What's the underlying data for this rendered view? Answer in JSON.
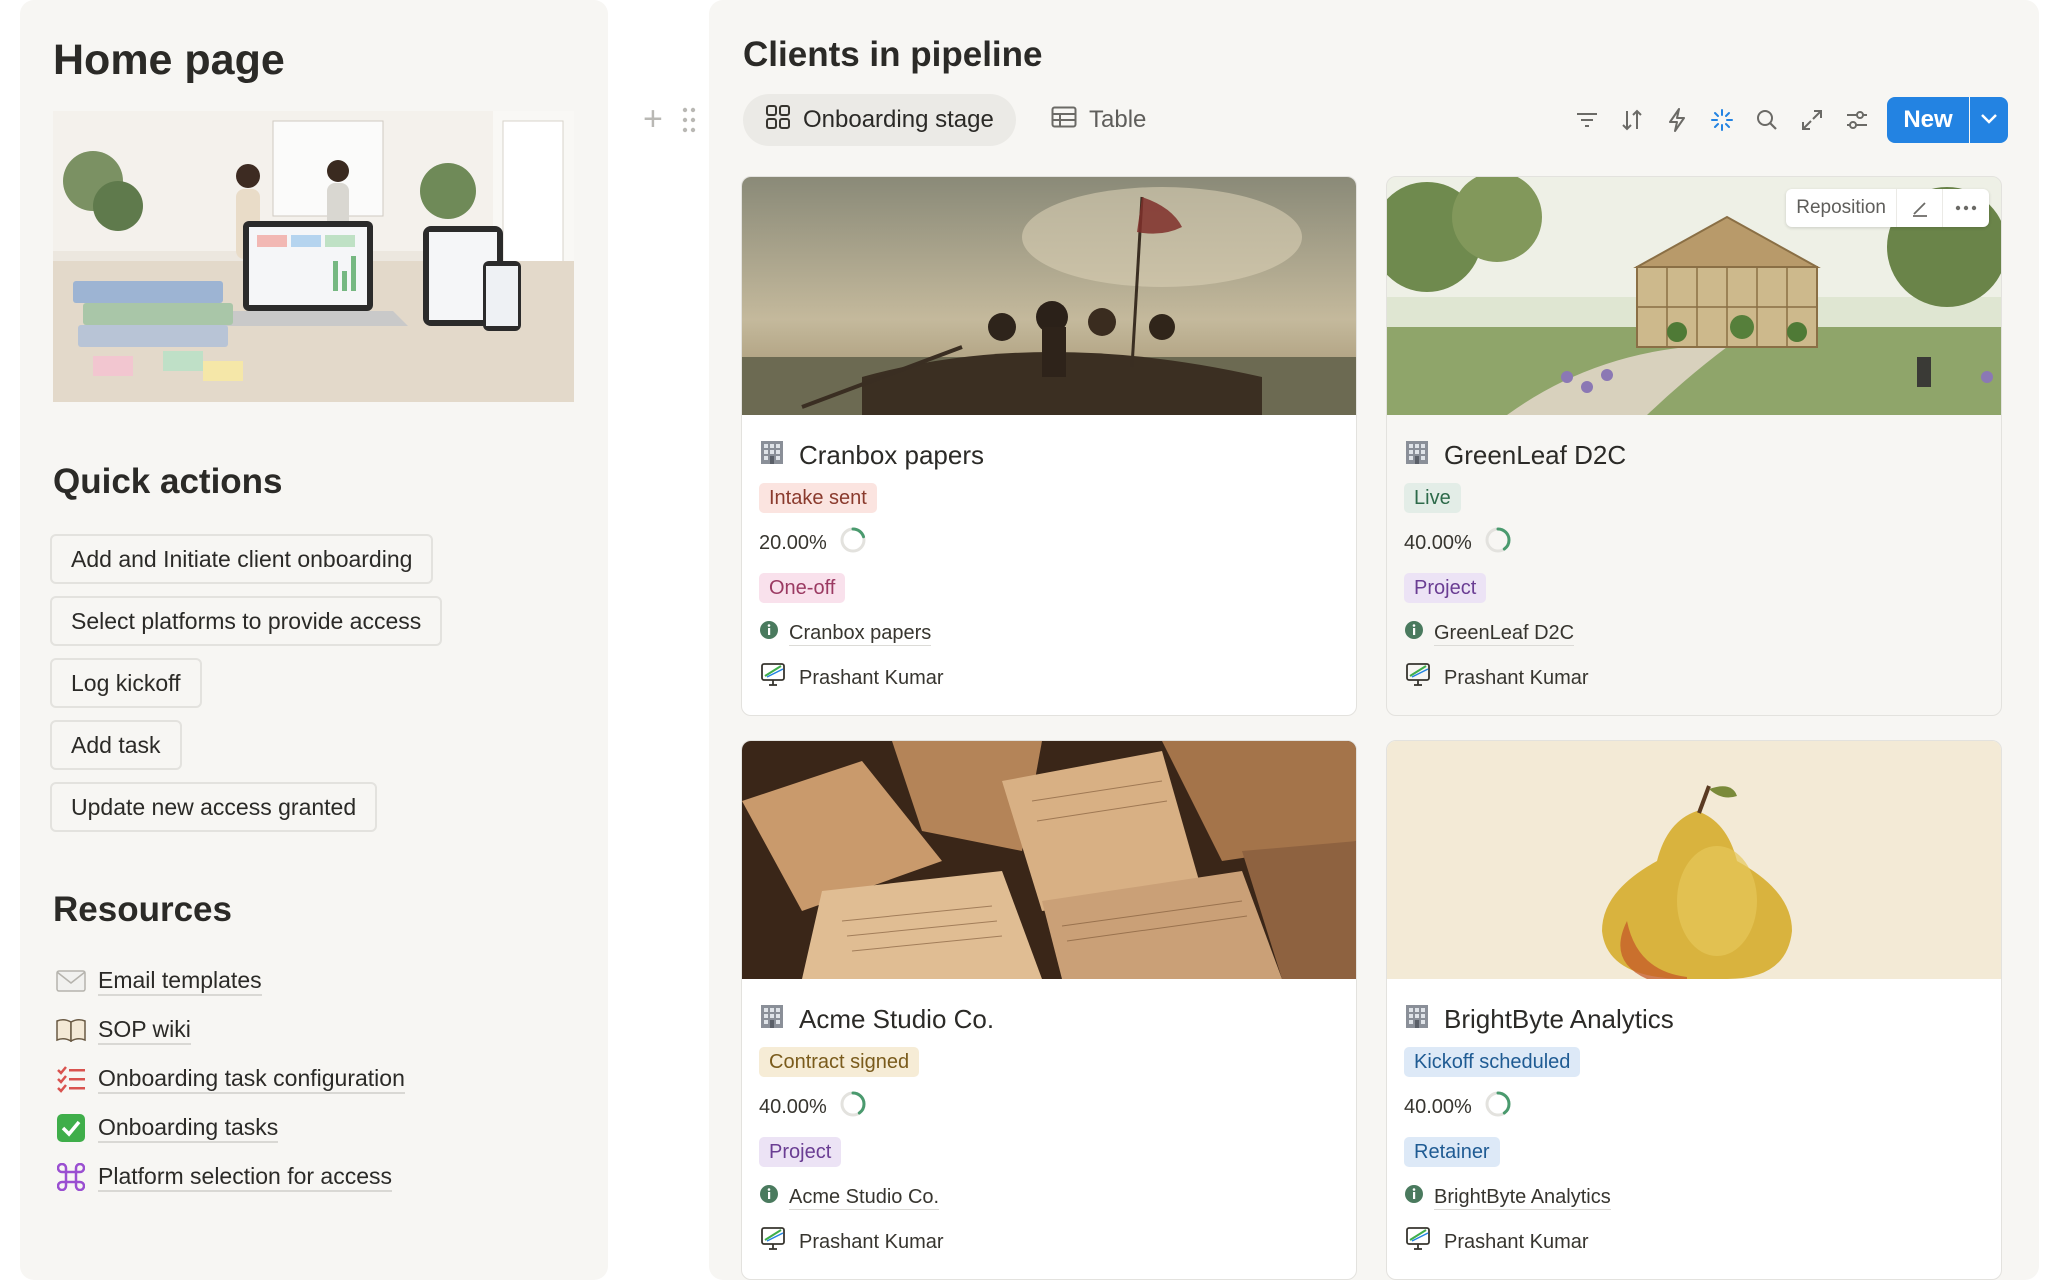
{
  "left": {
    "title": "Home page",
    "quick_actions_title": "Quick actions",
    "quick_actions": [
      {
        "label": "Add and Initiate client onboarding"
      },
      {
        "label": "Select platforms to provide access"
      },
      {
        "label": "Log kickoff"
      },
      {
        "label": "Add task"
      },
      {
        "label": "Update new access granted"
      }
    ],
    "resources_title": "Resources",
    "resources": [
      {
        "label": "Email templates",
        "icon": "envelope-icon"
      },
      {
        "label": "SOP wiki",
        "icon": "book-icon"
      },
      {
        "label": "Onboarding task configuration",
        "icon": "checklist-icon"
      },
      {
        "label": "Onboarding tasks",
        "icon": "check-box-icon"
      },
      {
        "label": "Platform selection for access",
        "icon": "command-key-icon"
      }
    ]
  },
  "right": {
    "title": "Clients in pipeline",
    "views": [
      {
        "label": "Onboarding stage",
        "icon": "gallery-icon",
        "active": true
      },
      {
        "label": "Table",
        "icon": "table-icon",
        "active": false
      }
    ],
    "toolbar_icons": [
      "filter-icon",
      "sort-icon",
      "automation-icon",
      "sparkle-icon",
      "search-icon",
      "expand-icon",
      "settings-icon"
    ],
    "new_label": "New",
    "reposition_label": "Reposition",
    "cards": [
      {
        "title": "Cranbox papers",
        "status": "Intake sent",
        "progress_label": "20.00%",
        "progress": 0.2,
        "type": "One-off",
        "company": "Cranbox papers",
        "owner": "Prashant Kumar",
        "cover": "painting-river-crossing"
      },
      {
        "title": "GreenLeaf D2C",
        "status": "Live",
        "progress_label": "40.00%",
        "progress": 0.4,
        "type": "Project",
        "company": "GreenLeaf D2C",
        "owner": "Prashant Kumar",
        "cover": "greenhouse-garden"
      },
      {
        "title": "Acme Studio Co.",
        "status": "Contract signed",
        "progress_label": "40.00%",
        "progress": 0.4,
        "type": "Project",
        "company": "Acme Studio Co.",
        "owner": "Prashant Kumar",
        "cover": "open-books"
      },
      {
        "title": "BrightByte Analytics",
        "status": "Kickoff scheduled",
        "progress_label": "40.00%",
        "progress": 0.4,
        "type": "Retainer",
        "company": "BrightByte Analytics",
        "owner": "Prashant Kumar",
        "cover": "pear"
      }
    ]
  },
  "colors": {
    "accent": "#2383e2",
    "status_red_bg": "#fbe4e0",
    "status_red_fg": "#8a3a2d",
    "status_green_bg": "#e3ede7",
    "status_green_fg": "#2d6a4a",
    "status_yellow_bg": "#f6ecd6",
    "status_yellow_fg": "#7a5b1c",
    "status_blue_bg": "#dde9f7",
    "status_blue_fg": "#1f5b93",
    "tag_pink_bg": "#f9e1ec",
    "tag_pink_fg": "#9b3a62",
    "tag_purple_bg": "#ece3f5",
    "tag_purple_fg": "#6a3d93",
    "tag_blue_bg": "#dde9f7",
    "tag_blue_fg": "#1f5b93",
    "progress_ring": "#4a9a6e"
  }
}
